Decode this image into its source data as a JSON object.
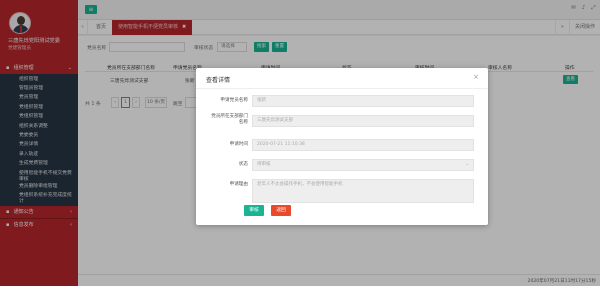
{
  "sidebar": {
    "user_name": "三唐先烁党阳测试党委",
    "user_role": "党建管理员",
    "groups": [
      {
        "label": "组织管理",
        "expanded": true
      },
      {
        "label": "通知公告",
        "expanded": false
      },
      {
        "label": "信息发布",
        "expanded": false
      }
    ],
    "items": [
      {
        "label": "组织管理"
      },
      {
        "label": "管理员管理"
      },
      {
        "label": "党员管理"
      },
      {
        "label": "党组织管理"
      },
      {
        "label": "党组织管理"
      },
      {
        "label": "组织关系调整"
      },
      {
        "label": "党委委员"
      },
      {
        "label": "党员详情"
      },
      {
        "label": "录入轨迹"
      },
      {
        "label": "生成党费管理"
      },
      {
        "label": "使用智能手机不规交党费审核"
      },
      {
        "label": "党员删除审批管理"
      },
      {
        "label": "党组织系统补充完成度统计"
      }
    ]
  },
  "tabs": {
    "home": "首页",
    "active": "使用智能手机不便党员审核",
    "right_label": "关闭操作"
  },
  "search": {
    "party_name_label": "党员名称",
    "status_label": "审核状态",
    "status_value": "请选择",
    "search_btn": "搜索",
    "reset_btn": "重置"
  },
  "table": {
    "headers": [
      "党员所在支部部门名称",
      "申请党员名称",
      "申请时间",
      "状态",
      "审核时间",
      "审核人名称",
      "操作"
    ],
    "rows": [
      {
        "dept": "三唐先烁测试支部",
        "name": "张新",
        "op": "查看"
      }
    ]
  },
  "pager": {
    "total_prefix": "共 1 条",
    "page": "1",
    "page_size": "10 条/页",
    "goto": "跳至"
  },
  "footer": {
    "time": "2020年07月21日11时17分15秒"
  },
  "modal": {
    "title": "查看详情",
    "fields": [
      {
        "label": "申请党员名称",
        "value": "张新"
      },
      {
        "label": "党员所在支部部门名称",
        "value": "三唐先烁测试支部"
      },
      {
        "label": "申请时间",
        "value": "2020-07-21 11:10:38"
      },
      {
        "label": "状态",
        "value": "待审核"
      },
      {
        "label": "申请理由",
        "value": "老年人不太会操作手机，不会使用智能手机"
      }
    ],
    "ok_btn": "审核",
    "back_btn": "返回"
  },
  "colors": {
    "sidebar_red": "#b7262c",
    "submenu_navy": "#263545",
    "accent_green": "#1ab394",
    "danger_red": "#e84b2b"
  }
}
